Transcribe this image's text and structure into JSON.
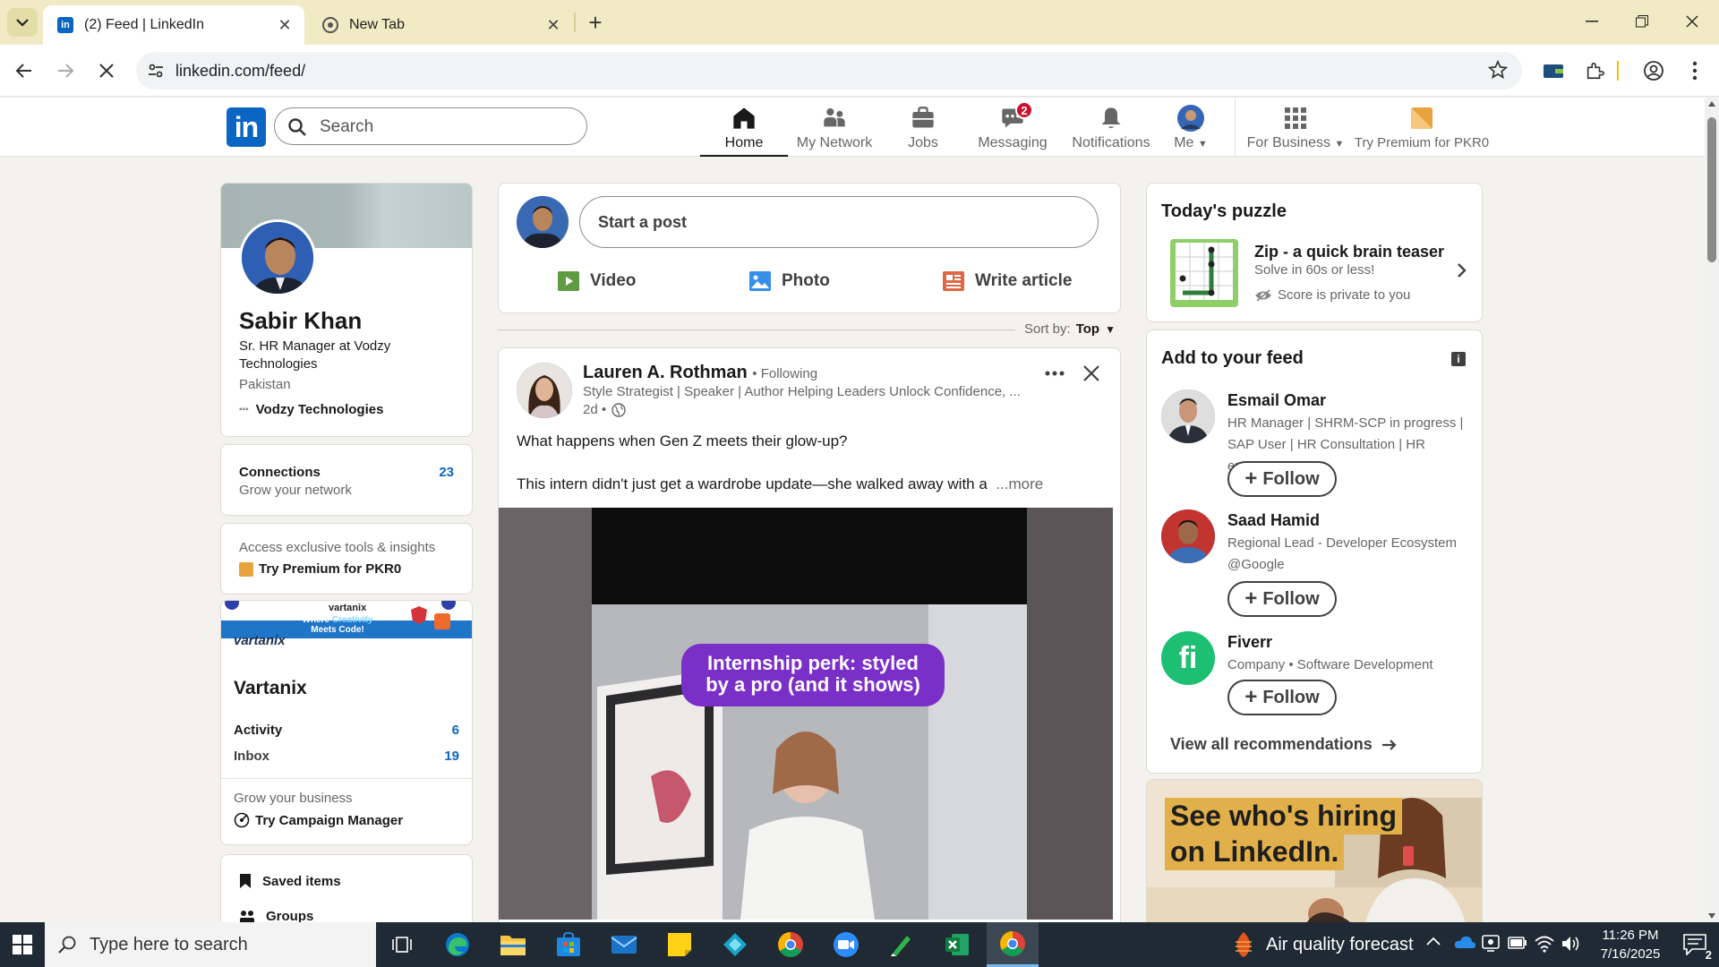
{
  "browser": {
    "tabs": [
      {
        "title": "(2) Feed | LinkedIn",
        "active": true
      },
      {
        "title": "New Tab",
        "active": false
      }
    ],
    "url": "linkedin.com/feed/"
  },
  "header": {
    "search_placeholder": "Search",
    "nav": {
      "home": "Home",
      "network": "My Network",
      "jobs": "Jobs",
      "messaging": "Messaging",
      "messaging_badge": "2",
      "notifications": "Notifications",
      "me": "Me",
      "business": "For Business",
      "premium": "Try Premium for PKR0"
    }
  },
  "profile": {
    "name": "Sabir Khan",
    "headline": "Sr. HR Manager at Vodzy Technologies",
    "location": "Pakistan",
    "company": "Vodzy Technologies",
    "connections_label": "Connections",
    "connections_sub": "Grow your network",
    "connections_count": "23",
    "premium_sub": "Access exclusive tools & insights",
    "premium_link": "Try Premium for PKR0"
  },
  "page_card": {
    "banner_brand": "vartanix",
    "banner_slogan_1": "Where",
    "banner_slogan_2": "Creativity",
    "banner_slogan_3": "Meets Code!",
    "banner_logo_text": "vartanix",
    "name": "Vartanix",
    "activity_label": "Activity",
    "activity_count": "6",
    "inbox_label": "Inbox",
    "inbox_count": "19",
    "grow_label": "Grow your business",
    "campaign_link": "Try Campaign Manager"
  },
  "left_links": {
    "saved": "Saved items",
    "groups": "Groups"
  },
  "composer": {
    "placeholder": "Start a post",
    "video": "Video",
    "photo": "Photo",
    "article": "Write article"
  },
  "sort": {
    "label": "Sort by:",
    "value": "Top"
  },
  "post": {
    "author": "Lauren A. Rothman",
    "following": "• Following",
    "headline": "Style Strategist | Speaker | Author Helping Leaders Unlock Confidence, ...",
    "age": "2d •",
    "line1": "What happens when Gen Z meets their glow-up?",
    "line2": "This intern didn't just get a wardrobe update—she walked away with a",
    "more": "...more",
    "video_caption_1": "Internship perk: styled",
    "video_caption_2": "by a pro (and it shows)"
  },
  "puzzle": {
    "title": "Today's puzzle",
    "name": "Zip - a quick brain teaser",
    "sub": "Solve in 60s or less!",
    "privacy": "Score is private to you"
  },
  "feed_suggestions": {
    "title": "Add to your feed",
    "follow_label": "Follow",
    "items": [
      {
        "name": "Esmail Omar",
        "sub": "HR Manager | SHRM-SCP in progress | SAP User | HR Consultation | HR expert..."
      },
      {
        "name": "Saad Hamid",
        "sub": "Regional Lead - Developer Ecosystem @Google"
      },
      {
        "name": "Fiverr",
        "sub": "Company • Software Development"
      }
    ],
    "view_all": "View all recommendations"
  },
  "ad": {
    "line1": "See who's hiring",
    "line2": "on LinkedIn."
  },
  "taskbar": {
    "search_placeholder": "Type here to search",
    "weather": "Air quality forecast",
    "time": "11:26 PM",
    "date": "7/16/2025",
    "notif_count": "2"
  },
  "colors": {
    "linkedin_blue": "#0a66c2",
    "tabstrip": "#f0ebc4",
    "page_bg": "#f4f2ee",
    "badge_red": "#cb112d"
  }
}
